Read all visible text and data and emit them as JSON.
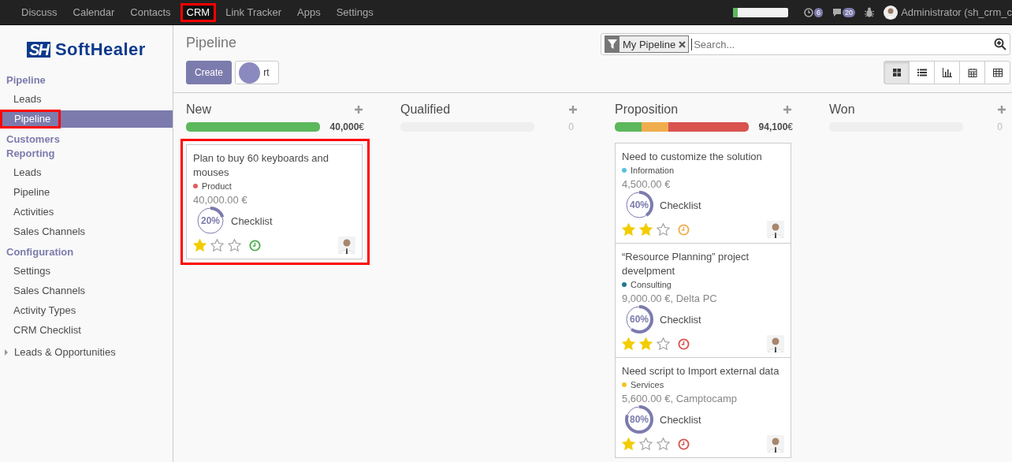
{
  "top_menu": [
    {
      "label": "Discuss",
      "highlighted": false
    },
    {
      "label": "Calendar",
      "highlighted": false
    },
    {
      "label": "Contacts",
      "highlighted": false
    },
    {
      "label": "CRM",
      "highlighted": true
    },
    {
      "label": "Link Tracker",
      "highlighted": false
    },
    {
      "label": "Apps",
      "highlighted": false
    },
    {
      "label": "Settings",
      "highlighted": false
    }
  ],
  "systray": {
    "progress": {
      "level": 0.08
    },
    "activities_badge": "6",
    "messages_badge": "20",
    "user": "Administrator (sh_crm_c"
  },
  "logo": {
    "mark": "SH",
    "name": "SoftHealer"
  },
  "sidebar": [
    {
      "title": "Pipeline",
      "items": [
        {
          "label": "Leads",
          "selected": false,
          "highlighted": false
        },
        {
          "label": "Pipeline",
          "selected": true,
          "highlighted": true
        }
      ]
    },
    {
      "title": "Customers Reporting",
      "items": [
        {
          "label": "Leads",
          "selected": false,
          "highlighted": false
        },
        {
          "label": "Pipeline",
          "selected": false,
          "highlighted": false
        },
        {
          "label": "Activities",
          "selected": false,
          "highlighted": false
        },
        {
          "label": "Sales Channels",
          "selected": false,
          "highlighted": false
        }
      ]
    },
    {
      "title": "Configuration",
      "items": [
        {
          "label": "Settings",
          "selected": false,
          "highlighted": false
        },
        {
          "label": "Sales Channels",
          "selected": false,
          "highlighted": false
        },
        {
          "label": "Activity Types",
          "selected": false,
          "highlighted": false
        },
        {
          "label": "CRM Checklist",
          "selected": false,
          "highlighted": false
        }
      ]
    }
  ],
  "sidebar_tree": [
    {
      "label": "Leads & Opportunities",
      "expanded": false
    }
  ],
  "page_title": "Pipeline",
  "buttons": [
    {
      "label": "Create",
      "kind": "primary"
    },
    {
      "label": "rt",
      "kind": "secondary"
    }
  ],
  "search": {
    "facet": "My Pipeline",
    "placeholder": "Search..."
  },
  "views": [
    {
      "kind": "kanban",
      "selected": true
    },
    {
      "kind": "list",
      "selected": false
    },
    {
      "kind": "graph",
      "selected": false
    },
    {
      "kind": "calendar",
      "selected": false
    },
    {
      "kind": "pivot",
      "selected": false
    }
  ],
  "columns": [
    {
      "title": "New",
      "total": "40,000",
      "currency": "€",
      "segments": [
        {
          "color": "#5cb85c",
          "level": 1
        }
      ],
      "cards": [
        {
          "title": "Plan to buy 60 keyboards and mouses",
          "tag": {
            "label": "Product",
            "color": "#e05d5d"
          },
          "amount": "40,000.00 €",
          "checklist": {
            "level": 0.2,
            "percent": "20%",
            "label": "Checklist"
          },
          "stars": 1,
          "activity": {
            "color": "#4cae4c"
          },
          "highlighted": true
        }
      ]
    },
    {
      "title": "Qualified",
      "total": "0",
      "level": 0
    },
    {
      "title": "Proposition",
      "total": "94,100",
      "currency": "€",
      "segments": [
        {
          "color": "#5cb85c",
          "level": 0.2
        },
        {
          "color": "#f0ad4e",
          "level": 0.2
        },
        {
          "color": "#d9534f",
          "level": 0.6
        }
      ],
      "cards": [
        {
          "title": "Need to customize the solution",
          "tag": {
            "label": "Information",
            "color": "#5bc0de"
          },
          "amount": "4,500.00 €",
          "checklist": {
            "level": 0.4,
            "percent": "40%",
            "label": "Checklist"
          },
          "stars": 2,
          "activity": {
            "color": "#f0ad4e"
          },
          "highlighted": false
        },
        {
          "title": "“Resource Planning” project develpment",
          "tag": {
            "label": "Consulting",
            "color": "#1f7a8c"
          },
          "amount": "9,000.00 €, Delta PC",
          "checklist": {
            "level": 0.6,
            "percent": "60%",
            "label": "Checklist"
          },
          "stars": 2,
          "activity": {
            "color": "#d9534f"
          },
          "highlighted": false
        },
        {
          "title": "Need script to Import external data",
          "tag": {
            "label": "Services",
            "color": "#f7c325"
          },
          "amount": "5,600.00 €, Camptocamp",
          "checklist": {
            "level": 0.8,
            "percent": "80%",
            "label": "Checklist"
          },
          "stars": 1,
          "activity": {
            "color": "#d9534f"
          },
          "highlighted": false
        }
      ]
    },
    {
      "title": "Won",
      "total": "0",
      "level": 0
    }
  ]
}
